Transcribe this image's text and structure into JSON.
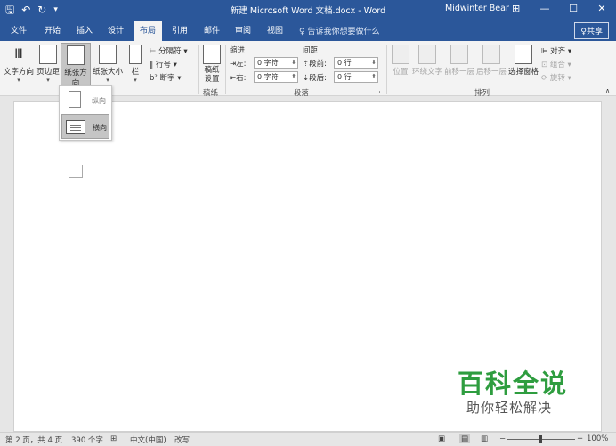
{
  "window": {
    "title": "新建 Microsoft Word 文档.docx  -  Word",
    "user": "Midwinter Bear",
    "ribbon_display": "⊞",
    "minimize": "—",
    "restore": "☐",
    "close": "✕"
  },
  "qat": {
    "save": "🖫",
    "undo": "↶",
    "redo": "↻",
    "more": "▾"
  },
  "tabs": [
    {
      "label": "文件"
    },
    {
      "label": "开始"
    },
    {
      "label": "插入"
    },
    {
      "label": "设计"
    },
    {
      "label": "布局"
    },
    {
      "label": "引用"
    },
    {
      "label": "邮件"
    },
    {
      "label": "审阅"
    },
    {
      "label": "视图"
    }
  ],
  "tell_me": "♀ 告诉我你想要做什么",
  "share": "♀共享",
  "page_setup": {
    "text_direction": "文字方向",
    "margins": "页边距",
    "orientation": "纸张方向",
    "size": "纸张大小",
    "columns": "栏",
    "breaks": "分隔符",
    "line_numbers": "行号",
    "hyphenation": "断字"
  },
  "draft": {
    "label": "稿纸设置",
    "group": "稿纸"
  },
  "paragraph": {
    "indent_header": "缩进",
    "spacing_header": "间距",
    "left_label": "左:",
    "right_label": "右:",
    "before_label": "段前:",
    "after_label": "段后:",
    "left_value": "0 字符",
    "right_value": "0 字符",
    "before_value": "0 行",
    "after_value": "0 行",
    "group": "段落"
  },
  "arrange": {
    "position": "位置",
    "wrap": "环绕文字",
    "forward": "前移一层",
    "backward": "后移一层",
    "selection_pane": "选择窗格",
    "align": "对齐",
    "group_btn": "组合",
    "rotate": "旋转",
    "group": "排列"
  },
  "orientation_menu": {
    "portrait": "纵向",
    "landscape": "横向"
  },
  "watermark": {
    "title": "百科全说",
    "subtitle": "助你轻松解决"
  },
  "status": {
    "page": "第 2 页，共 4 页",
    "words": "390 个字",
    "language": "中文(中国)",
    "mode": "改写",
    "zoom_minus": "−",
    "zoom_plus": "+",
    "zoom": "100%"
  }
}
